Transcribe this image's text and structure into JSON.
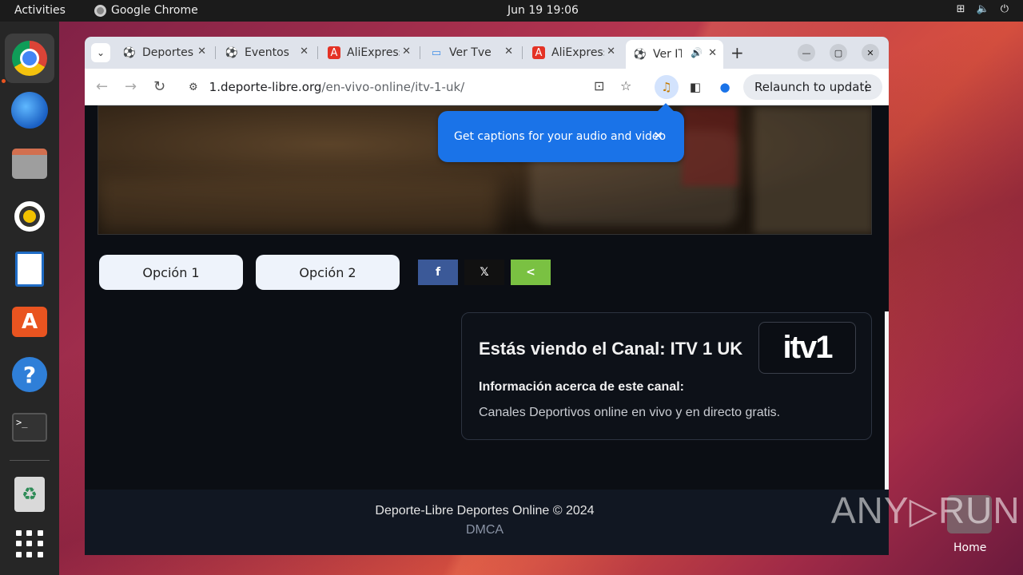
{
  "topbar": {
    "activities": "Activities",
    "app_name": "Google Chrome",
    "datetime": "Jun 19  19:06"
  },
  "dock": {
    "items": [
      "chrome",
      "thunderbird",
      "files",
      "rhythmbox",
      "libreoffice-writer",
      "app-center",
      "help",
      "terminal",
      "trash",
      "show-apps"
    ]
  },
  "browser": {
    "tabs": [
      {
        "title": "Deportes",
        "favicon": "soccer-ball-icon"
      },
      {
        "title": "Eventos",
        "favicon": "soccer-ball-icon"
      },
      {
        "title": "AliExpress",
        "favicon": "aliexpress-icon"
      },
      {
        "title": "Ver Tve",
        "favicon": "tv-icon"
      },
      {
        "title": "AliExpress",
        "favicon": "aliexpress-icon"
      },
      {
        "title": "Ver ITV",
        "favicon": "soccer-ball-icon",
        "active": true,
        "audio": true
      }
    ],
    "url_host": "1.deporte-libre.org",
    "url_path": "/en-vivo-online/itv-1-uk/",
    "relaunch_label": "Relaunch to update",
    "caption_popup": "Get captions for your audio and video"
  },
  "page": {
    "option1": "Opción 1",
    "option2": "Opción 2",
    "share": {
      "facebook": "f",
      "twitter": "𝕏",
      "share": "<"
    },
    "channel_title": "Estás viendo el Canal: ITV 1 UK",
    "channel_logo": "itv1",
    "info_heading": "Información acerca de este canal:",
    "info_text": "Canales Deportivos online en vivo y en directo gratis.",
    "footer_copy": "Deporte-Libre Deportes Online © 2024",
    "footer_dmca": "DMCA"
  },
  "desktop": {
    "watermark": "ANY▷RUN",
    "home_label": "Home"
  },
  "colors": {
    "accent_blue": "#1a73e8",
    "ubuntu_orange": "#e95420",
    "page_bg": "#0b0e14"
  }
}
